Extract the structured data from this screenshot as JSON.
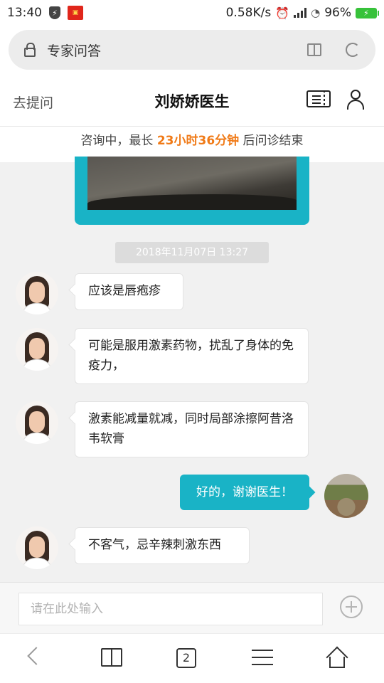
{
  "status_bar": {
    "time": "13:40",
    "speed": "0.58K/s",
    "battery": "96%"
  },
  "url_bar": {
    "title": "专家问答"
  },
  "header": {
    "ask_label": "去提问",
    "title": "刘娇娇医生"
  },
  "notice": {
    "prefix": "咨询中，最长 ",
    "remaining": "23小时36分钟",
    "suffix": " 后问诊结束"
  },
  "chat": {
    "timestamp": "2018年11月07日 13:27",
    "messages": [
      {
        "sender": "doctor",
        "text": "应该是唇疱疹"
      },
      {
        "sender": "doctor",
        "text": "可能是服用激素药物，扰乱了身体的免疫力，"
      },
      {
        "sender": "doctor",
        "text": "激素能减量就减，同时局部涂擦阿昔洛韦软膏"
      },
      {
        "sender": "user",
        "text": "好的，谢谢医生！"
      },
      {
        "sender": "doctor",
        "text": "不客气，忌辛辣刺激东西"
      }
    ]
  },
  "input": {
    "placeholder": "请在此处输入"
  },
  "bottom_nav": {
    "tab_count": "2"
  },
  "colors": {
    "accent": "#19b3c6",
    "highlight": "#f07a17"
  }
}
